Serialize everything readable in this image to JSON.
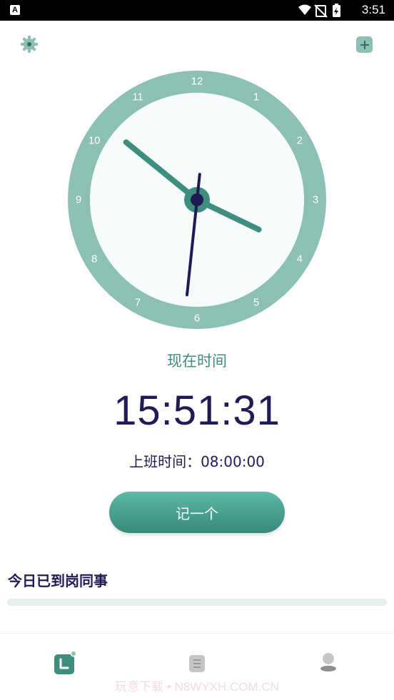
{
  "status_bar": {
    "app_badge": "A",
    "time": "3:51"
  },
  "clock": {
    "numbers": [
      "12",
      "1",
      "2",
      "3",
      "4",
      "5",
      "6",
      "7",
      "8",
      "9",
      "10",
      "11"
    ],
    "hour": 3,
    "minute": 51,
    "second": 31,
    "colors": {
      "ring": "#8cc0b4",
      "face": "#f5fcfb",
      "hour_minute_hand": "#3e8e7f",
      "second_hand": "#1f1c55"
    }
  },
  "main": {
    "now_label": "现在时间",
    "current_time": "15:51:31",
    "work_time": "上班时间：08:00:00",
    "record_button": "记一个"
  },
  "section": {
    "title": "今日已到岗同事"
  },
  "watermark": "玩意下载 • N8WYXH.COM.CN",
  "icons": {
    "settings": "gear-icon",
    "add": "plus-icon",
    "nav_clock": "clock-tab-icon",
    "nav_list": "list-tab-icon",
    "nav_profile": "profile-tab-icon"
  },
  "accent_color": "#3e8e7f"
}
